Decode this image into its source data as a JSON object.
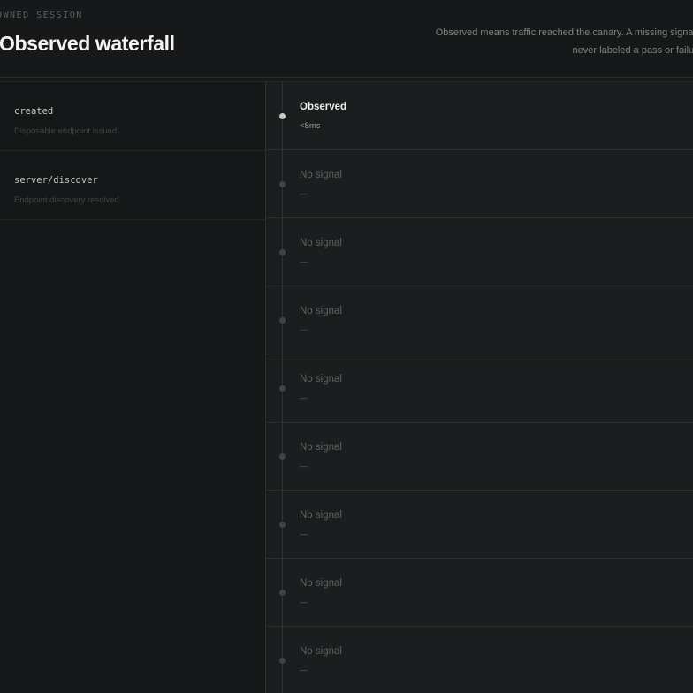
{
  "header": {
    "eyebrow": "OWNED SESSION",
    "title": "Observed waterfall",
    "note": "Observed means traffic reached the canary. A missing signal is never labeled a pass or failure."
  },
  "stages": [
    {
      "name": "created",
      "description": "Disposable endpoint issued"
    },
    {
      "name": "server/discover",
      "description": "Endpoint discovery resolved"
    }
  ],
  "events": [
    {
      "status": "Observed",
      "metric": "<8ms",
      "active": true
    },
    {
      "status": "No signal",
      "metric": "—",
      "active": false
    },
    {
      "status": "No signal",
      "metric": "—",
      "active": false
    },
    {
      "status": "No signal",
      "metric": "—",
      "active": false
    },
    {
      "status": "No signal",
      "metric": "—",
      "active": false
    },
    {
      "status": "No signal",
      "metric": "—",
      "active": false
    },
    {
      "status": "No signal",
      "metric": "—",
      "active": false
    },
    {
      "status": "No signal",
      "metric": "—",
      "active": false
    },
    {
      "status": "No signal",
      "metric": "—",
      "active": false
    }
  ]
}
